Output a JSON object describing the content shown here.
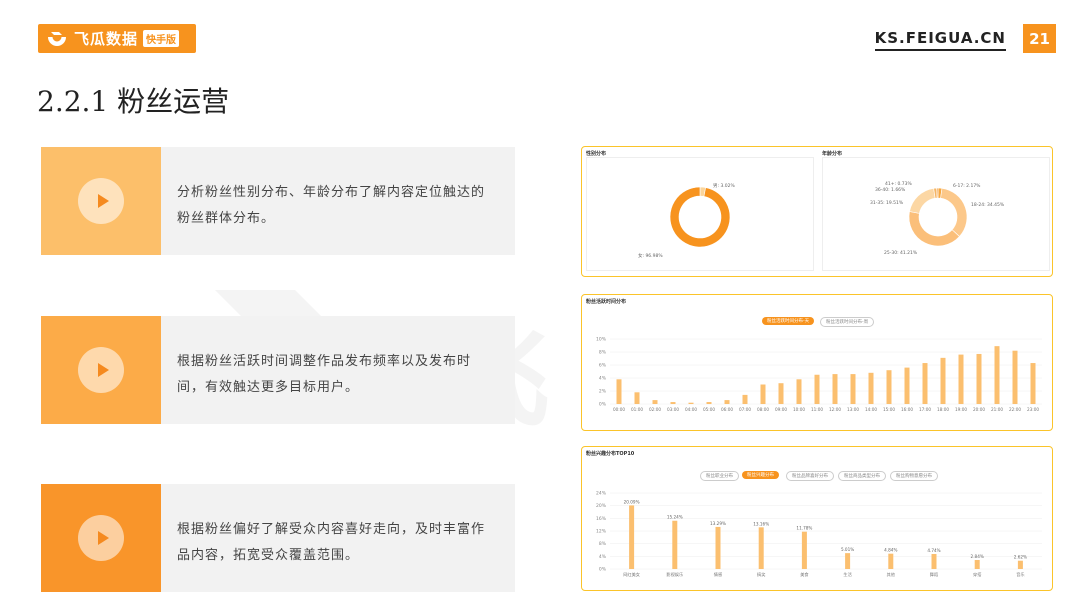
{
  "header": {
    "logo_text": "飞瓜数据",
    "logo_badge": "快手版",
    "site_url": "KS.FEIGUA.CN",
    "page_number": "21"
  },
  "title": "2.2.1 粉丝运营",
  "watermark": "飞瓜数据",
  "cards": [
    {
      "text": "分析粉丝性别分布、年龄分布了解内容定位触达的粉丝群体分布。"
    },
    {
      "text": "根据粉丝活跃时间调整作品发布频率以及发布时间，有效触达更多目标用户。"
    },
    {
      "text": "根据粉丝偏好了解受众内容喜好走向，及时丰富作品内容，拓宽受众覆盖范围。"
    }
  ],
  "panel1": {
    "gender_title": "性别分布",
    "age_title": "年龄分布",
    "gender_chart": {
      "type": "pie",
      "categories": [
        "男",
        "女"
      ],
      "values": [
        3.02,
        96.98
      ],
      "labels": [
        "男: 3.02%",
        "女: 96.98%"
      ],
      "colors": [
        "#fbd59b",
        "#f7931e"
      ]
    },
    "age_chart": {
      "type": "pie",
      "categories": [
        "6-17",
        "18-24",
        "25-30",
        "31-35",
        "36-40",
        "41+"
      ],
      "values": [
        2.17,
        34.45,
        41.21,
        19.51,
        1.66,
        0.73
      ],
      "labels": [
        "6-17: 2.17%",
        "18-24: 34.45%",
        "25-30: 41.21%",
        "31-35: 19.51%",
        "36-40: 1.66%",
        "41+: 0.73%"
      ],
      "colors": [
        "#f7a740",
        "#fcc88a",
        "#fbbf7a",
        "#fcd7a4",
        "#f5b565",
        "#f29f45"
      ]
    }
  },
  "panel2": {
    "title": "粉丝活跃时间分布",
    "tabs": [
      "粉丝活跃时间分布-天",
      "粉丝活跃时间分布-周"
    ],
    "chart_data": {
      "type": "bar",
      "categories": [
        "00:00",
        "01:00",
        "02:00",
        "03:00",
        "04:00",
        "05:00",
        "06:00",
        "07:00",
        "08:00",
        "09:00",
        "10:00",
        "11:00",
        "12:00",
        "13:00",
        "14:00",
        "15:00",
        "16:00",
        "17:00",
        "18:00",
        "19:00",
        "20:00",
        "21:00",
        "22:00",
        "23:00"
      ],
      "values": [
        3.8,
        1.8,
        0.6,
        0.3,
        0.2,
        0.3,
        0.6,
        1.4,
        3.0,
        3.2,
        3.8,
        4.5,
        4.6,
        4.6,
        4.8,
        5.2,
        5.6,
        6.3,
        7.1,
        7.6,
        7.7,
        8.9,
        8.2,
        6.3
      ],
      "yticks": [
        "0%",
        "2%",
        "4%",
        "6%",
        "8%",
        "10%"
      ],
      "ylim": [
        0,
        10
      ],
      "color": "#fbbf6f"
    }
  },
  "panel3": {
    "title": "粉丝兴趣分布TOP10",
    "tabs": [
      "粉丝职业分布",
      "粉丝兴趣分布",
      "粉丝品牌喜好分布",
      "粉丝商品类型分布",
      "粉丝购物意愿分布"
    ],
    "active_tab": 1,
    "chart_data": {
      "type": "bar",
      "categories": [
        "网红美女",
        "影视娱乐",
        "情感",
        "搞笑",
        "美食",
        "生活",
        "其他",
        "舞蹈",
        "穿搭",
        "音乐"
      ],
      "values": [
        20.09,
        15.24,
        13.29,
        13.16,
        11.78,
        5.01,
        4.84,
        4.74,
        2.84,
        2.62
      ],
      "data_labels": [
        "20.09%",
        "15.24%",
        "13.29%",
        "13.16%",
        "11.78%",
        "5.01%",
        "4.84%",
        "4.74%",
        "2.84%",
        "2.62%"
      ],
      "yticks": [
        "0%",
        "4%",
        "8%",
        "12%",
        "16%",
        "20%",
        "24%"
      ],
      "ylim": [
        0,
        24
      ],
      "color": "#fbbf6f"
    }
  }
}
